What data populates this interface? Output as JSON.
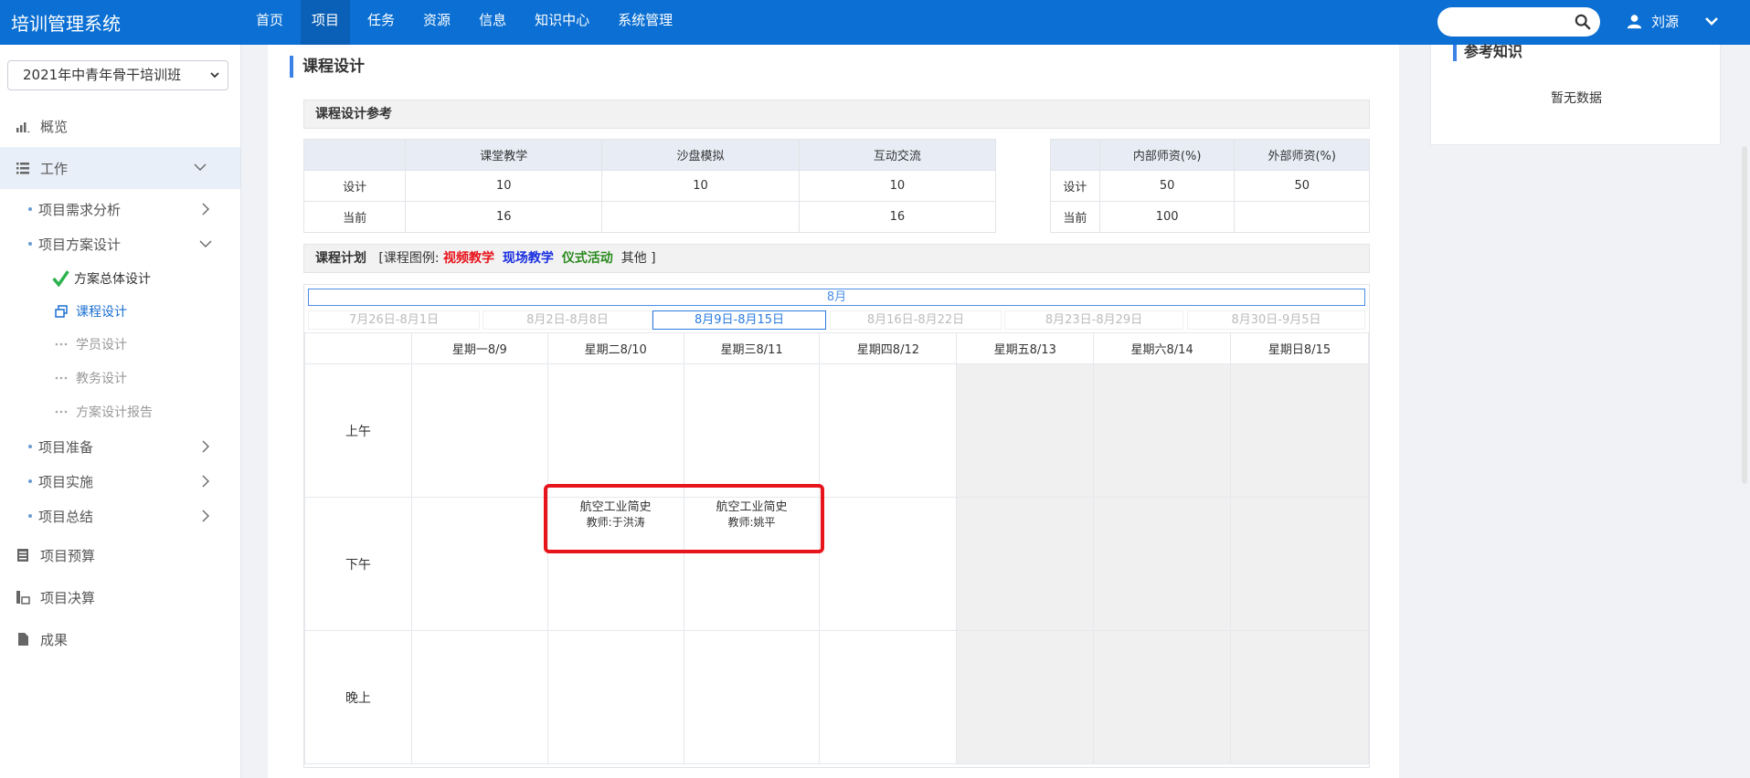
{
  "app": {
    "title": "培训管理系统"
  },
  "nav": [
    {
      "label": "首页"
    },
    {
      "label": "项目"
    },
    {
      "label": "任务"
    },
    {
      "label": "资源"
    },
    {
      "label": "信息"
    },
    {
      "label": "知识中心"
    },
    {
      "label": "系统管理"
    }
  ],
  "user": {
    "name": "刘源"
  },
  "search": {
    "placeholder": ""
  },
  "sidebar": {
    "class_select": "2021年中青年骨干培训班",
    "overview": "概览",
    "work": "工作",
    "sub": {
      "demand": "项目需求分析",
      "plan": "项目方案设计",
      "prepare": "项目准备",
      "implement": "项目实施",
      "summary": "项目总结"
    },
    "leaves": {
      "overall": "方案总体设计",
      "course": "课程设计",
      "student": "学员设计",
      "affairs": "教务设计",
      "report": "方案设计报告"
    },
    "budget": "项目预算",
    "final": "项目决算",
    "result": "成果"
  },
  "main": {
    "title": "课程设计",
    "reference_head": "课程设计参考",
    "ref_table": {
      "headers": [
        "",
        "课堂教学",
        "沙盘模拟",
        "互动交流"
      ],
      "rows": [
        [
          "设计",
          "10",
          "10",
          "10"
        ],
        [
          "当前",
          "16",
          "",
          "16"
        ]
      ]
    },
    "staff_table": {
      "headers": [
        "",
        "内部师资(%)",
        "外部师资(%)"
      ],
      "rows": [
        [
          "设计",
          "50",
          "50"
        ],
        [
          "当前",
          "100",
          ""
        ]
      ]
    },
    "plan_head": "课程计划",
    "legend": {
      "prefix": "[课程图例:",
      "video": "视频教学",
      "onsite": "现场教学",
      "ceremony": "仪式活动",
      "other": "其他",
      "suffix": "]"
    },
    "schedule": {
      "month": "8月",
      "weeks": [
        "7月26日-8月1日",
        "8月2日-8月8日",
        "8月9日-8月15日",
        "8月16日-8月22日",
        "8月23日-8月29日",
        "8月30日-9月5日"
      ],
      "days": [
        "星期一8/9",
        "星期二8/10",
        "星期三8/11",
        "星期四8/12",
        "星期五8/13",
        "星期六8/14",
        "星期日8/15"
      ],
      "periods": [
        "上午",
        "下午",
        "晚上"
      ],
      "courses": {
        "tue_pm": {
          "title": "航空工业简史",
          "teacher": "教师:于洪涛"
        },
        "wed_pm": {
          "title": "航空工业简史",
          "teacher": "教师:姚平"
        }
      }
    }
  },
  "right_panel": {
    "title": "参考知识",
    "empty": "暂无数据"
  },
  "colors": {
    "topbar": "#0b6fd3",
    "accent": "#3b82e6",
    "highlight": "#e8141c",
    "legend_video": "#e8141c",
    "legend_onsite": "#1a2fe0",
    "legend_ceremony": "#2a8a1e"
  }
}
